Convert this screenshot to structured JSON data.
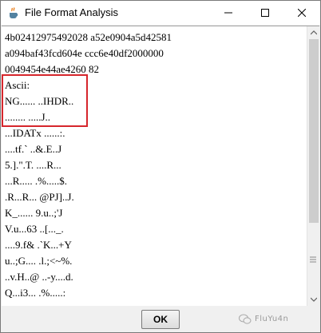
{
  "window": {
    "title": "File Format Analysis",
    "icon": "java-coffee-icon"
  },
  "content": {
    "lines": [
      "4b02412975492028 a52e0904a5d42581",
      "a094baf43fcd604e ccc6e40df2000000",
      "0049454e44ae4260 82",
      "Ascii:",
      "NG...... ..IHDR..",
      "........ .....J..",
      "...IDATx ......:.",
      "....tf.` ..&.E..J",
      "5.].\".T. ....R...",
      "...R..... .%.....$.",
      ".R...R... @PJ]..J.",
      "K_...... 9.u..;'J",
      "V.u...63 ..[..._.",
      "....9.f& .`K...+Y",
      "u..;G.... .l.;<~%.",
      "..v.H..@ ..-y....d.",
      "Q...i3... .%.....:"
    ]
  },
  "footer": {
    "ok_label": "OK",
    "watermark": "FluYu4n"
  },
  "colors": {
    "highlight": "#d6262c",
    "titlebar": "#ffffff",
    "background": "#f0f0f0"
  }
}
